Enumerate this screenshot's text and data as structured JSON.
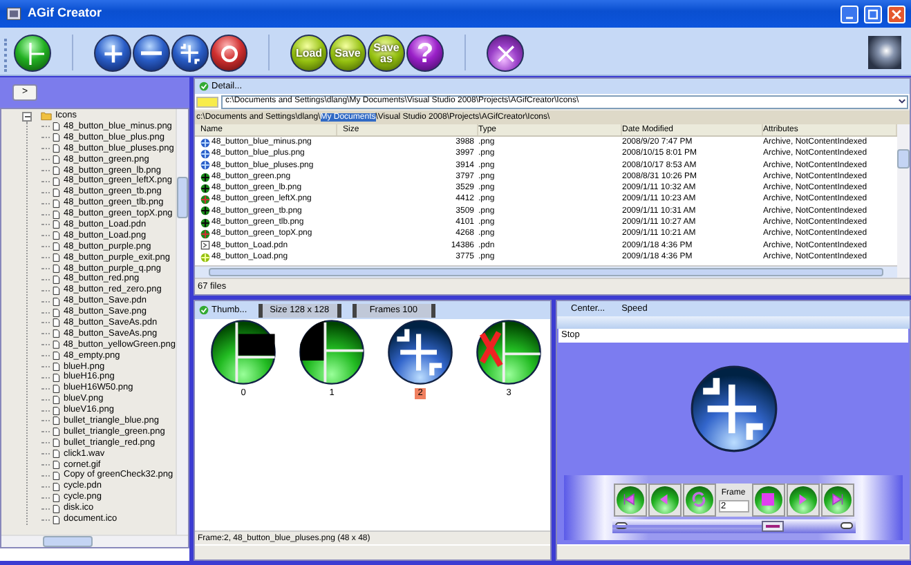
{
  "window": {
    "title": "AGif Creator"
  },
  "toolbar": [
    {
      "kind": "green-cross"
    },
    {
      "kind": "separator"
    },
    {
      "kind": "blue-plus"
    },
    {
      "kind": "blue-minus"
    },
    {
      "kind": "blue-pluses"
    },
    {
      "kind": "red-ring"
    },
    {
      "kind": "separator"
    },
    {
      "kind": "load",
      "label": "Load"
    },
    {
      "kind": "save",
      "label": "Save"
    },
    {
      "kind": "saveas",
      "label": "Save as"
    },
    {
      "kind": "help",
      "label": "?"
    },
    {
      "kind": "separator"
    },
    {
      "kind": "purple-x"
    }
  ],
  "sidebar": {
    "expand_button": ">",
    "tree": {
      "label": "Icons",
      "expanded": true,
      "children": [
        {
          "label": "48_button_blue_minus.png"
        },
        {
          "label": "48_button_blue_plus.png"
        },
        {
          "label": "48_button_blue_pluses.png"
        },
        {
          "label": "48_button_green.png"
        },
        {
          "label": "48_button_green_lb.png"
        },
        {
          "label": "48_button_green_leftX.png"
        },
        {
          "label": "48_button_green_tb.png"
        },
        {
          "label": "48_button_green_tlb.png"
        },
        {
          "label": "48_button_green_topX.png"
        },
        {
          "label": "48_button_Load.pdn"
        },
        {
          "label": "48_button_Load.png"
        },
        {
          "label": "48_button_purple.png"
        },
        {
          "label": "48_button_purple_exit.png"
        },
        {
          "label": "48_button_purple_q.png"
        },
        {
          "label": "48_button_red.png"
        },
        {
          "label": "48_button_red_zero.png"
        },
        {
          "label": "48_button_Save.pdn"
        },
        {
          "label": "48_button_Save.png"
        },
        {
          "label": "48_button_SaveAs.pdn"
        },
        {
          "label": "48_button_SaveAs.png"
        },
        {
          "label": "48_button_yellowGreen.png"
        },
        {
          "label": "48_empty.png"
        },
        {
          "label": "blueH.png"
        },
        {
          "label": "blueH16.png"
        },
        {
          "label": "blueH16W50.png"
        },
        {
          "label": "blueV.png"
        },
        {
          "label": "blueV16.png"
        },
        {
          "label": "bullet_triangle_blue.png"
        },
        {
          "label": "bullet_triangle_green.png"
        },
        {
          "label": "bullet_triangle_red.png"
        },
        {
          "label": "click1.wav"
        },
        {
          "label": "cornet.gif"
        },
        {
          "label": "Copy of greenCheck32.png"
        },
        {
          "label": "cycle.pdn"
        },
        {
          "label": "cycle.png"
        },
        {
          "label": "disk.ico"
        },
        {
          "label": "document.ico"
        }
      ]
    }
  },
  "browser": {
    "view_button": "Detail...",
    "path_field": "c:\\Documents and Settings\\dlang\\My Documents\\Visual Studio 2008\\Projects\\AGifCreator\\Icons\\",
    "path_parts": [
      {
        "text": "c:\\Documents and Settings\\dlang\\",
        "selected": false
      },
      {
        "text": "My Documents",
        "selected": true
      },
      {
        "text": "\\Visual Studio 2008\\Projects\\AGifCreator\\Icons\\",
        "selected": false
      }
    ],
    "columns": [
      "Name",
      "Size",
      "Type",
      "Date Modified",
      "Attributes"
    ],
    "rows": [
      {
        "kind": "blue",
        "cells": [
          "48_button_blue_minus.png",
          "3988",
          ".png",
          "2008/9/20 7:47 PM",
          "Archive, NotContentIndexed"
        ]
      },
      {
        "kind": "blue",
        "cells": [
          "48_button_blue_plus.png",
          "3997",
          ".png",
          "2008/10/15 8:01 PM",
          "Archive, NotContentIndexed"
        ]
      },
      {
        "kind": "blue",
        "cells": [
          "48_button_blue_pluses.png",
          "3914",
          ".png",
          "2008/10/17 8:53 AM",
          "Archive, NotContentIndexed"
        ]
      },
      {
        "kind": "green",
        "cells": [
          "48_button_green.png",
          "3797",
          ".png",
          "2008/8/31 10:26 PM",
          "Archive, NotContentIndexed"
        ]
      },
      {
        "kind": "green",
        "cells": [
          "48_button_green_lb.png",
          "3529",
          ".png",
          "2009/1/11 10:32 AM",
          "Archive, NotContentIndexed"
        ]
      },
      {
        "kind": "green-red",
        "cells": [
          "48_button_green_leftX.png",
          "4412",
          ".png",
          "2009/1/11 10:23 AM",
          "Archive, NotContentIndexed"
        ]
      },
      {
        "kind": "green",
        "cells": [
          "48_button_green_tb.png",
          "3509",
          ".png",
          "2009/1/11 10:31 AM",
          "Archive, NotContentIndexed"
        ]
      },
      {
        "kind": "green",
        "cells": [
          "48_button_green_tlb.png",
          "4101",
          ".png",
          "2009/1/11 10:27 AM",
          "Archive, NotContentIndexed"
        ]
      },
      {
        "kind": "green-red",
        "cells": [
          "48_button_green_topX.png",
          "4268",
          ".png",
          "2009/1/11 10:21 AM",
          "Archive, NotContentIndexed"
        ]
      },
      {
        "kind": "doc",
        "cells": [
          "48_button_Load.pdn",
          "14386",
          ".pdn",
          "2009/1/18 4:36 PM",
          "Archive, NotContentIndexed"
        ]
      },
      {
        "kind": "yellow",
        "cells": [
          "48_button_Load.png",
          "3775",
          ".png",
          "2009/1/18 4:36 PM",
          "Archive, NotContentIndexed"
        ]
      }
    ],
    "status": "67 files"
  },
  "frames": {
    "view_button": "Thumb...",
    "size_button": "Size 128 x 128",
    "frames_button": "Frames 100",
    "thumbnails": [
      {
        "kind": "green-tl",
        "label": "0",
        "selected": false
      },
      {
        "kind": "green-l",
        "label": "1",
        "selected": false
      },
      {
        "kind": "blue-pluses",
        "label": "2",
        "selected": true
      },
      {
        "kind": "green-x",
        "label": "3",
        "selected": false
      }
    ],
    "status": "Frame:2, 48_button_blue_pluses.png (48 x 48)"
  },
  "preview": {
    "tabs": [
      "Center...",
      "Speed"
    ],
    "state_field": "Stop",
    "controls": [
      {
        "kind": "first"
      },
      {
        "kind": "prev"
      },
      {
        "kind": "loop"
      },
      {
        "kind": "frame",
        "label": "Frame",
        "value": "2"
      },
      {
        "kind": "stop"
      },
      {
        "kind": "next"
      },
      {
        "kind": "last"
      }
    ],
    "slider": {
      "level": 0.66
    }
  }
}
